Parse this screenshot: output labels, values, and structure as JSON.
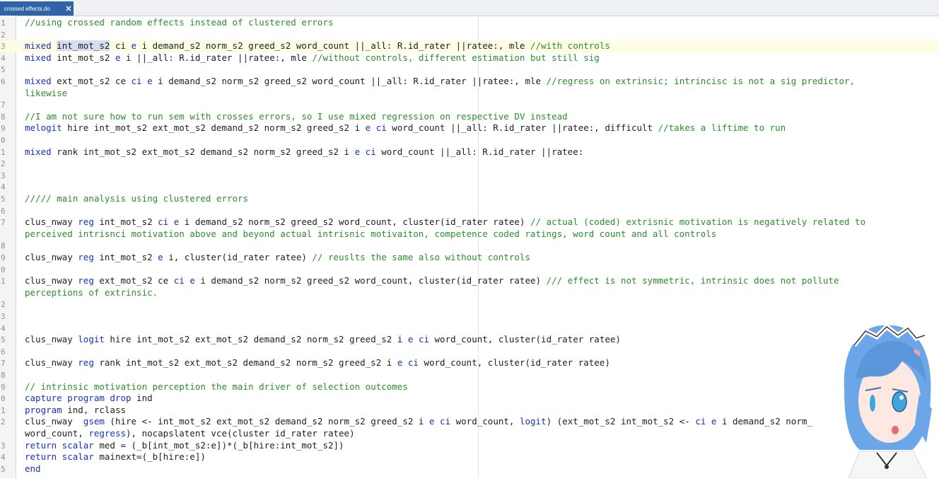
{
  "tab": {
    "title": "crossed effects.do",
    "close": "✕"
  },
  "lines": [
    {
      "n": "1",
      "segs": [
        {
          "t": "c",
          "s": "//using crossed random effects instead of clustered errors"
        }
      ]
    },
    {
      "n": "2",
      "segs": []
    },
    {
      "n": "3",
      "current": true,
      "segs": [
        {
          "t": "k",
          "s": "mixed"
        },
        {
          "t": "p",
          "s": " "
        },
        {
          "t": "sel",
          "s": "int_mot_s2"
        },
        {
          "t": "p",
          "s": " ci "
        },
        {
          "t": "k",
          "s": "e"
        },
        {
          "t": "p",
          "s": " i demand_s2 norm_s2 greed_s2 word_count ||_all: R.id_rater ||ratee:, mle "
        },
        {
          "t": "c",
          "s": "//with controls"
        }
      ]
    },
    {
      "n": "4",
      "segs": [
        {
          "t": "k",
          "s": "mixed"
        },
        {
          "t": "p",
          "s": " int_mot_s2 "
        },
        {
          "t": "k",
          "s": "e"
        },
        {
          "t": "p",
          "s": " i ||_all: R.id_rater ||ratee:, mle "
        },
        {
          "t": "c",
          "s": "//without controls, different estimation but still sig"
        }
      ]
    },
    {
      "n": "5",
      "segs": []
    },
    {
      "n": "6",
      "segs": [
        {
          "t": "k",
          "s": "mixed"
        },
        {
          "t": "p",
          "s": " ext_mot_s2 ce "
        },
        {
          "t": "k",
          "s": "ci"
        },
        {
          "t": "p",
          "s": " "
        },
        {
          "t": "k",
          "s": "e"
        },
        {
          "t": "p",
          "s": " i demand_s2 norm_s2 greed_s2 word_count ||_all: R.id_rater ||ratee:, mle "
        },
        {
          "t": "c",
          "s": "//regress on extrinsic; intrincisc is not a sig predictor,"
        }
      ]
    },
    {
      "n": "",
      "segs": [
        {
          "t": "c",
          "s": "likewise"
        }
      ]
    },
    {
      "n": "7",
      "segs": []
    },
    {
      "n": "8",
      "segs": [
        {
          "t": "c",
          "s": "//I am not sure how to run sem with crosses errors, so I use mixed regression on respective DV instead"
        }
      ]
    },
    {
      "n": "9",
      "segs": [
        {
          "t": "k",
          "s": "melogit"
        },
        {
          "t": "p",
          "s": " hire int_mot_s2 ext_mot_s2 demand_s2 norm_s2 greed_s2 i "
        },
        {
          "t": "k",
          "s": "e"
        },
        {
          "t": "p",
          "s": " "
        },
        {
          "t": "k",
          "s": "ci"
        },
        {
          "t": "p",
          "s": " word_count ||_all: R.id_rater ||ratee:, difficult "
        },
        {
          "t": "c",
          "s": "//takes a liftime to run"
        }
      ]
    },
    {
      "n": "0",
      "segs": []
    },
    {
      "n": "1",
      "segs": [
        {
          "t": "k",
          "s": "mixed"
        },
        {
          "t": "p",
          "s": " rank int_mot_s2 ext_mot_s2 demand_s2 norm_s2 greed_s2 i "
        },
        {
          "t": "k",
          "s": "e"
        },
        {
          "t": "p",
          "s": " "
        },
        {
          "t": "k",
          "s": "ci"
        },
        {
          "t": "p",
          "s": " word_count ||_all: R.id_rater ||ratee:"
        }
      ]
    },
    {
      "n": "2",
      "segs": []
    },
    {
      "n": "3",
      "segs": []
    },
    {
      "n": "4",
      "segs": []
    },
    {
      "n": "5",
      "segs": [
        {
          "t": "c",
          "s": "///// main analysis using clustered errors"
        }
      ]
    },
    {
      "n": "6",
      "segs": []
    },
    {
      "n": "7",
      "segs": [
        {
          "t": "p",
          "s": "clus_nway "
        },
        {
          "t": "k",
          "s": "reg"
        },
        {
          "t": "p",
          "s": " int_mot_s2 "
        },
        {
          "t": "k",
          "s": "ci"
        },
        {
          "t": "p",
          "s": " "
        },
        {
          "t": "k",
          "s": "e"
        },
        {
          "t": "p",
          "s": " i demand_s2 norm_s2 greed_s2 word_count, cluster(id_rater ratee) "
        },
        {
          "t": "c",
          "s": "// actual (coded) extrisnic motivation is negatively related to"
        }
      ]
    },
    {
      "n": "",
      "segs": [
        {
          "t": "c",
          "s": "perceived intrisnci motivation above and beyond actual intrisnic motivaiton, competence coded ratings, word count and all controls"
        }
      ]
    },
    {
      "n": "8",
      "segs": []
    },
    {
      "n": "9",
      "segs": [
        {
          "t": "p",
          "s": "clus_nway "
        },
        {
          "t": "k",
          "s": "reg"
        },
        {
          "t": "p",
          "s": " int_mot_s2 "
        },
        {
          "t": "k",
          "s": "e"
        },
        {
          "t": "p",
          "s": " i, cluster(id_rater ratee) "
        },
        {
          "t": "c",
          "s": "// reuslts the same also without controls"
        }
      ]
    },
    {
      "n": "0",
      "segs": []
    },
    {
      "n": "1",
      "segs": [
        {
          "t": "p",
          "s": "clus_nway "
        },
        {
          "t": "k",
          "s": "reg"
        },
        {
          "t": "p",
          "s": " ext_mot_s2 ce "
        },
        {
          "t": "k",
          "s": "ci"
        },
        {
          "t": "p",
          "s": " "
        },
        {
          "t": "k",
          "s": "e"
        },
        {
          "t": "p",
          "s": " i demand_s2 norm_s2 greed_s2 word_count, cluster(id_rater ratee) "
        },
        {
          "t": "c",
          "s": "/// effect is not symmetric, intrinsic does not pollute"
        }
      ]
    },
    {
      "n": "",
      "segs": [
        {
          "t": "c",
          "s": "perceptions of extrinsic."
        }
      ]
    },
    {
      "n": "2",
      "segs": []
    },
    {
      "n": "3",
      "segs": []
    },
    {
      "n": "4",
      "segs": []
    },
    {
      "n": "5",
      "segs": [
        {
          "t": "p",
          "s": "clus_nway "
        },
        {
          "t": "k",
          "s": "logit"
        },
        {
          "t": "p",
          "s": " hire int_mot_s2 ext_mot_s2 demand_s2 norm_s2 greed_s2 i "
        },
        {
          "t": "k",
          "s": "e"
        },
        {
          "t": "p",
          "s": " "
        },
        {
          "t": "k",
          "s": "ci"
        },
        {
          "t": "p",
          "s": " word_count, cluster(id_rater ratee)"
        }
      ]
    },
    {
      "n": "6",
      "segs": []
    },
    {
      "n": "7",
      "segs": [
        {
          "t": "p",
          "s": "clus_nway "
        },
        {
          "t": "k",
          "s": "reg"
        },
        {
          "t": "p",
          "s": " rank int_mot_s2 ext_mot_s2 demand_s2 norm_s2 greed_s2 i "
        },
        {
          "t": "k",
          "s": "e"
        },
        {
          "t": "p",
          "s": " "
        },
        {
          "t": "k",
          "s": "ci"
        },
        {
          "t": "p",
          "s": " word_count, cluster(id_rater ratee)"
        }
      ]
    },
    {
      "n": "8",
      "segs": []
    },
    {
      "n": "9",
      "segs": [
        {
          "t": "c",
          "s": "// intrinsic motivation perception the main driver of selection outcomes"
        }
      ]
    },
    {
      "n": "0",
      "segs": [
        {
          "t": "k",
          "s": "capture program drop"
        },
        {
          "t": "p",
          "s": " ind"
        }
      ]
    },
    {
      "n": "1",
      "segs": [
        {
          "t": "k",
          "s": "program"
        },
        {
          "t": "p",
          "s": " ind, rclass"
        }
      ]
    },
    {
      "n": "2",
      "segs": [
        {
          "t": "p",
          "s": "clus_nway  "
        },
        {
          "t": "k",
          "s": "gsem"
        },
        {
          "t": "p",
          "s": " (hire <- int_mot_s2 ext_mot_s2 demand_s2 norm_s2 greed_s2 i "
        },
        {
          "t": "k",
          "s": "e"
        },
        {
          "t": "p",
          "s": " "
        },
        {
          "t": "k",
          "s": "ci"
        },
        {
          "t": "p",
          "s": " word_count, "
        },
        {
          "t": "k",
          "s": "logit"
        },
        {
          "t": "p",
          "s": ") (ext_mot_s2 int_mot_s2 <- "
        },
        {
          "t": "k",
          "s": "ci"
        },
        {
          "t": "p",
          "s": " "
        },
        {
          "t": "k",
          "s": "e"
        },
        {
          "t": "p",
          "s": " i demand_s2 norm_"
        }
      ]
    },
    {
      "n": "",
      "segs": [
        {
          "t": "p",
          "s": "word_count, "
        },
        {
          "t": "k",
          "s": "regress"
        },
        {
          "t": "p",
          "s": "), nocapslatent vce(cluster id_rater ratee)"
        }
      ]
    },
    {
      "n": "3",
      "segs": [
        {
          "t": "k",
          "s": "return scalar"
        },
        {
          "t": "p",
          "s": " med = (_b[int_mot_s2:e])*(_b[hire:int_mot_s2])"
        }
      ]
    },
    {
      "n": "4",
      "segs": [
        {
          "t": "k",
          "s": "return scalar"
        },
        {
          "t": "p",
          "s": " mainext=(_b[hire:e])"
        }
      ]
    },
    {
      "n": "5",
      "segs": [
        {
          "t": "k",
          "s": "end"
        }
      ]
    }
  ],
  "colors": {
    "tab": "#2f64a8",
    "keyword": "#1530c8",
    "comment": "#2a8f2a",
    "current_line": "#fefde4",
    "selection": "#d6dcf2"
  },
  "avatar": {
    "icon": "anime-character-avatar-icon",
    "hair": "#6aa6e8",
    "eye": "#3fa5e0",
    "skin": "#fde9e2"
  }
}
